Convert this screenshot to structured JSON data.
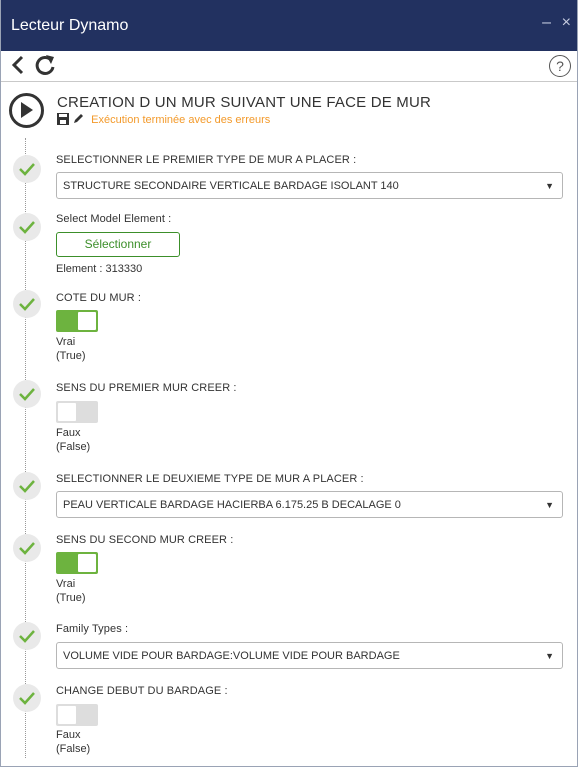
{
  "window": {
    "title": "Lecteur Dynamo",
    "minimize": "–",
    "close": "×"
  },
  "toolbar": {
    "help": "?"
  },
  "graph": {
    "title": "CREATION D UN MUR SUIVANT UNE FACE DE MUR",
    "status": "Exécution terminée avec des erreurs"
  },
  "inputs": [
    {
      "label": "SELECTIONNER LE PREMIER TYPE DE MUR A PLACER :",
      "value": "STRUCTURE SECONDAIRE VERTICALE BARDAGE ISOLANT 140"
    },
    {
      "label": "Select Model Element :",
      "button": "Sélectionner",
      "element": "Element : 313330"
    },
    {
      "label": "COTE DU MUR :",
      "state": "Vrai",
      "state2": "(True)"
    },
    {
      "label": "SENS DU PREMIER MUR CREER :",
      "state": "Faux",
      "state2": "(False)"
    },
    {
      "label": "SELECTIONNER LE DEUXIEME TYPE DE MUR A PLACER :",
      "value": "PEAU VERTICALE BARDAGE HACIERBA 6.175.25 B DECALAGE 0"
    },
    {
      "label": "SENS DU SECOND MUR CREER :",
      "state": "Vrai",
      "state2": "(True)"
    },
    {
      "label": "Family Types :",
      "value": "VOLUME VIDE POUR BARDAGE:VOLUME VIDE POUR BARDAGE"
    },
    {
      "label": "CHANGE DEBUT DU BARDAGE :",
      "state": "Faux",
      "state2": "(False)"
    }
  ],
  "icons": {
    "back": "back-arrow-icon",
    "refresh": "refresh-icon",
    "help": "help-icon",
    "play": "play-icon",
    "save": "save-icon",
    "edit": "pencil-icon",
    "check": "check-icon",
    "dropdown": "dropdown-arrow-icon"
  },
  "colors": {
    "titlebar": "#223160",
    "accent": "#6db33f",
    "warning": "#f39a2b",
    "button": "#3c8f2a"
  }
}
